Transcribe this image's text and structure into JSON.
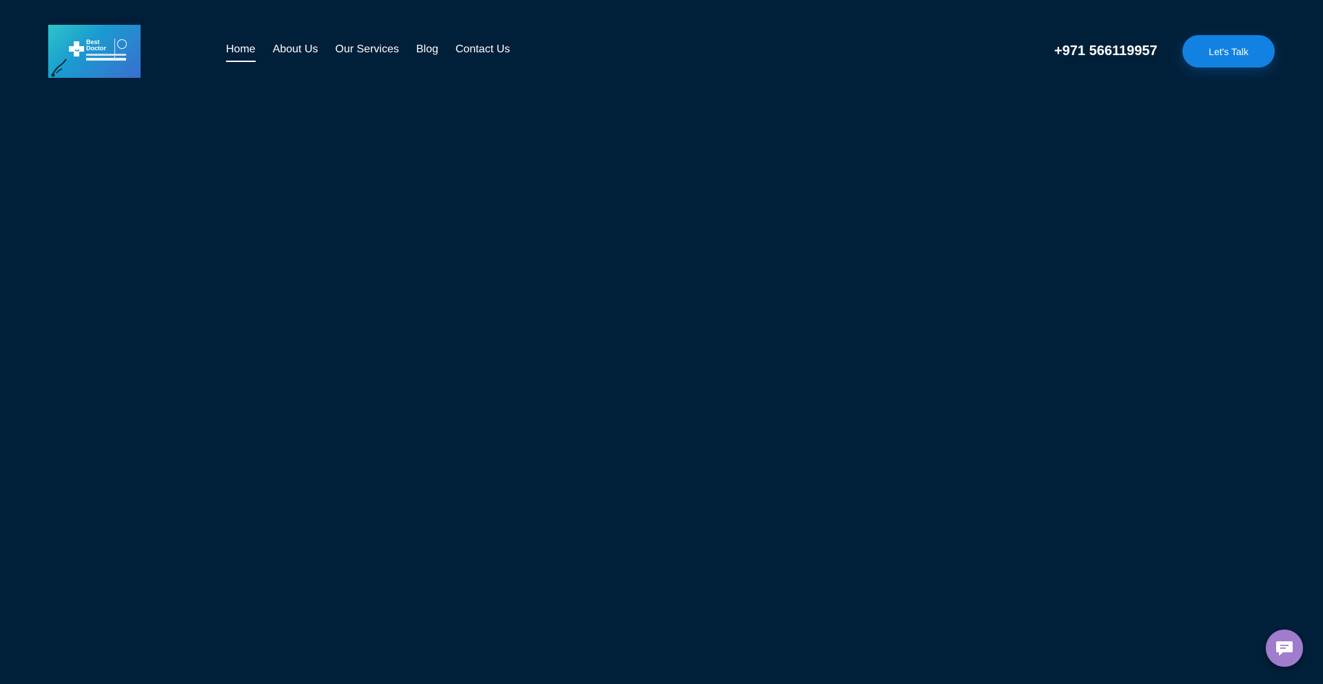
{
  "logo": {
    "brand_text": "Best\nDoctor",
    "colors": {
      "gradient_start": "#2ec4c9",
      "gradient_end": "#3a6fcf"
    }
  },
  "nav": {
    "items": [
      {
        "label": "Home",
        "active": true
      },
      {
        "label": "About Us",
        "active": false
      },
      {
        "label": "Our Services",
        "active": false
      },
      {
        "label": "Blog",
        "active": false
      },
      {
        "label": "Contact Us",
        "active": false
      }
    ]
  },
  "header": {
    "phone": "+971 566119957",
    "cta_label": "Let's Talk"
  },
  "chat_widget": {
    "icon": "chat-bubble-icon"
  },
  "colors": {
    "background": "#00203a",
    "accent": "#1282e2",
    "chat_widget": "#a07ccc",
    "text": "#ffffff"
  }
}
